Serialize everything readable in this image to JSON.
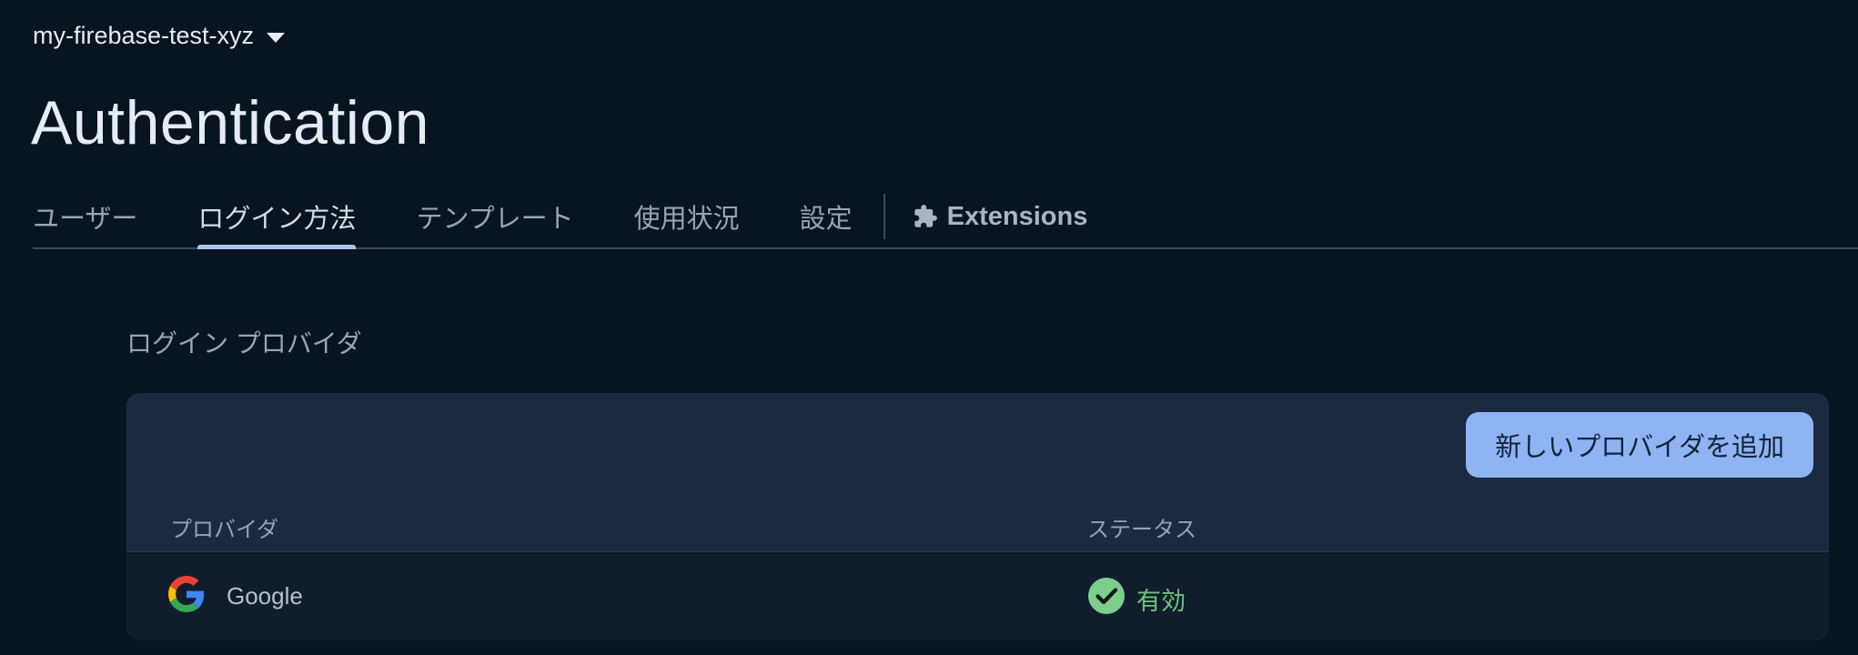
{
  "project": {
    "name": "my-firebase-test-xyz",
    "dropdown_icon": "caret-down-icon"
  },
  "page": {
    "title": "Authentication"
  },
  "tabs": [
    {
      "label": "ユーザー",
      "active": false
    },
    {
      "label": "ログイン方法",
      "active": true
    },
    {
      "label": "テンプレート",
      "active": false
    },
    {
      "label": "使用状況",
      "active": false
    },
    {
      "label": "設定",
      "active": false
    },
    {
      "label": "Extensions",
      "active": false,
      "icon": "puzzle-icon"
    }
  ],
  "section": {
    "label": "ログイン プロバイダ"
  },
  "toolbar": {
    "add_provider_label": "新しいプロバイダを追加"
  },
  "table": {
    "columns": [
      "プロバイダ",
      "ステータス"
    ],
    "rows": [
      {
        "provider": "Google",
        "provider_icon": "google-logo-icon",
        "status": "有効",
        "status_icon": "check-circle-icon"
      }
    ]
  },
  "colors": {
    "background": "#08141f",
    "card": "#1b2a40",
    "accent": "#8eb4f4",
    "status_enabled": "#6fc47e"
  }
}
